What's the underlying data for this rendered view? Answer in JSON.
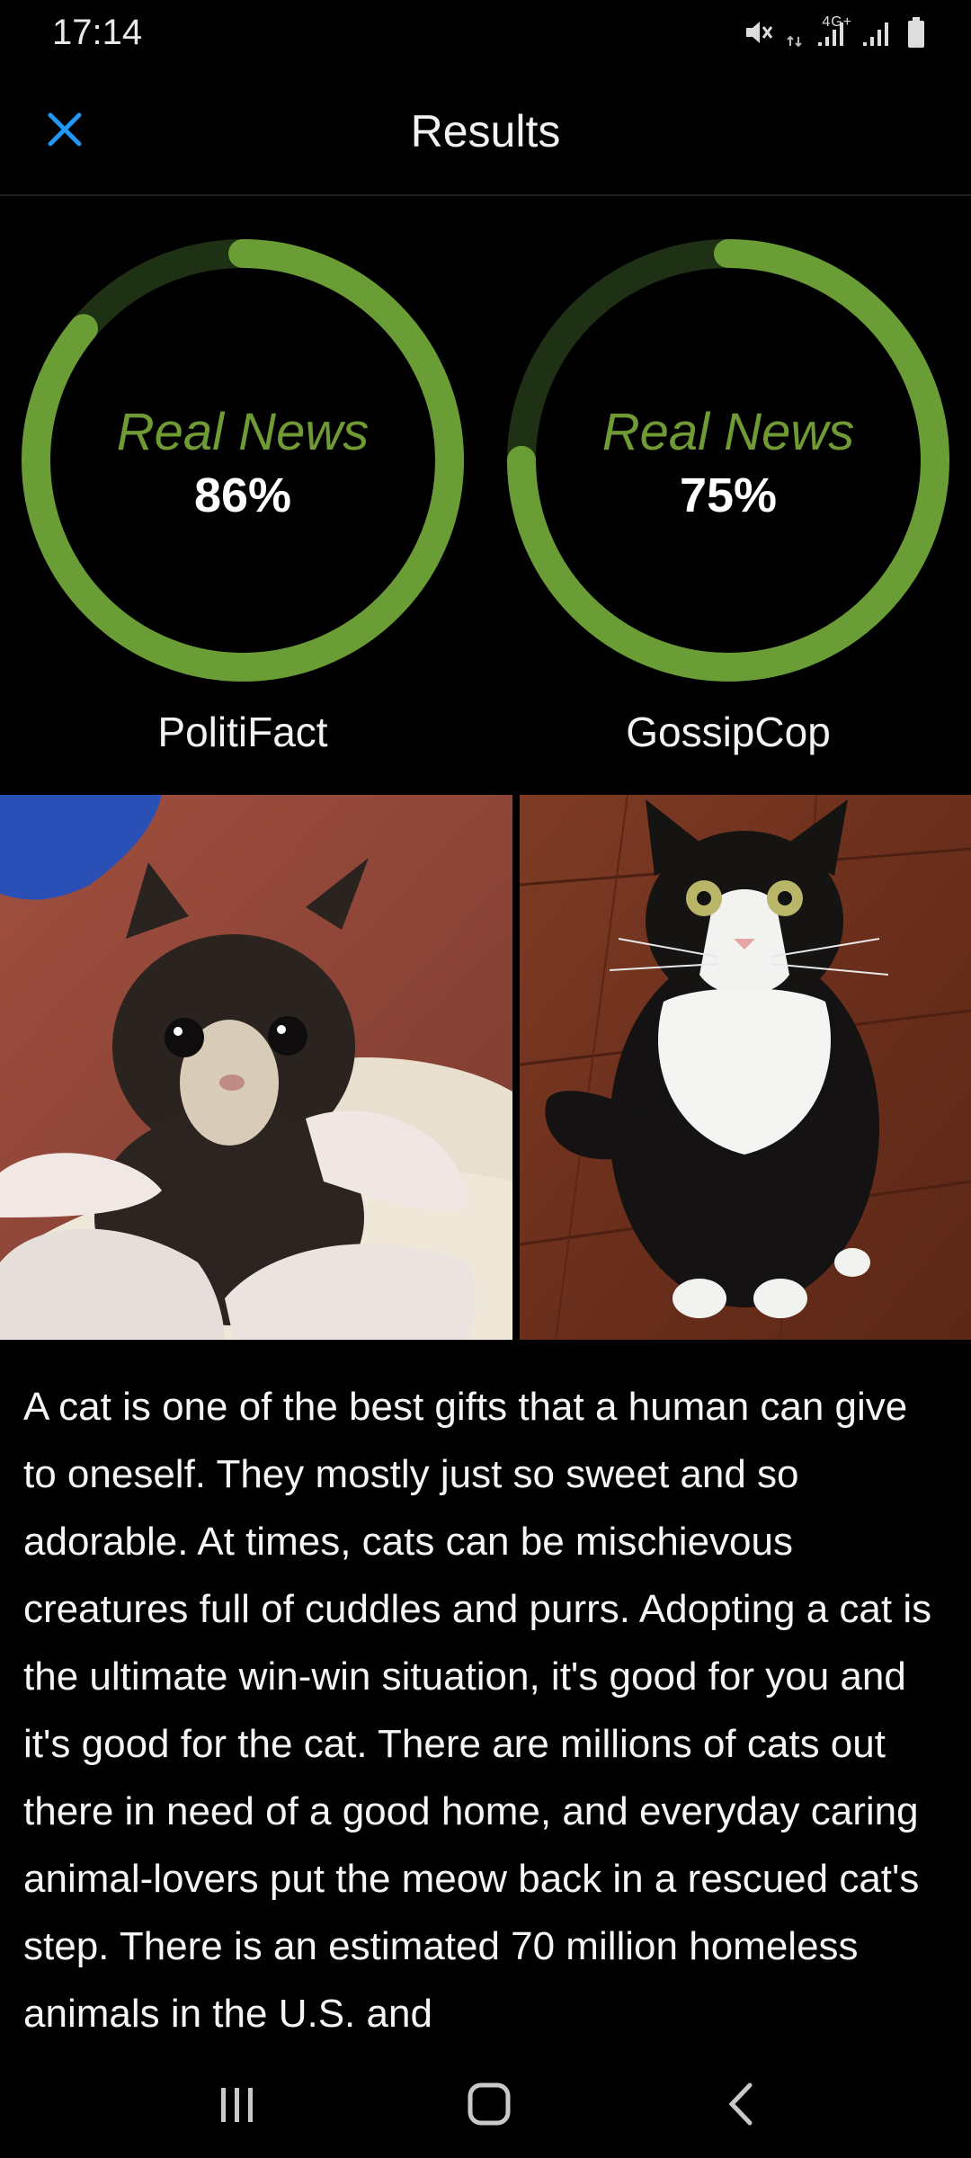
{
  "status_bar": {
    "time": "17:14",
    "network": "4G+",
    "icons": [
      "mute-icon",
      "network-4g-icon",
      "signal-icon",
      "signal-icon",
      "battery-icon"
    ]
  },
  "app_bar": {
    "title": "Results",
    "close_icon": "close-icon",
    "accent_color": "#2196f3"
  },
  "gauges": [
    {
      "label": "Real News",
      "value_text": "86%",
      "value": 0.86,
      "source": "PolitiFact"
    },
    {
      "label": "Real News",
      "value_text": "75%",
      "value": 0.75,
      "source": "GossipCop"
    }
  ],
  "gauge_colors": {
    "fill": "#6a9d35",
    "track": "#1f3114",
    "label": "#6f9a34"
  },
  "images": [
    {
      "name": "photo-kitten-in-gloved-hands"
    },
    {
      "name": "photo-tuxedo-cat-on-floor"
    }
  ],
  "article": {
    "text": "A cat is one of the best gifts that a human can give to oneself. They mostly just so sweet and so adorable. At times, cats can be mischievous creatures full of cuddles and purrs. Adopting a cat is the ultimate win-win situation, it's good for you and it's good for the cat. There are millions of cats out there in need of a good home, and everyday caring animal-lovers put the meow back in a rescued cat's step. There is an estimated 70 million homeless animals in the U.S. and"
  },
  "nav_bar": {
    "items": [
      "recent-apps-icon",
      "home-icon",
      "back-icon"
    ]
  }
}
